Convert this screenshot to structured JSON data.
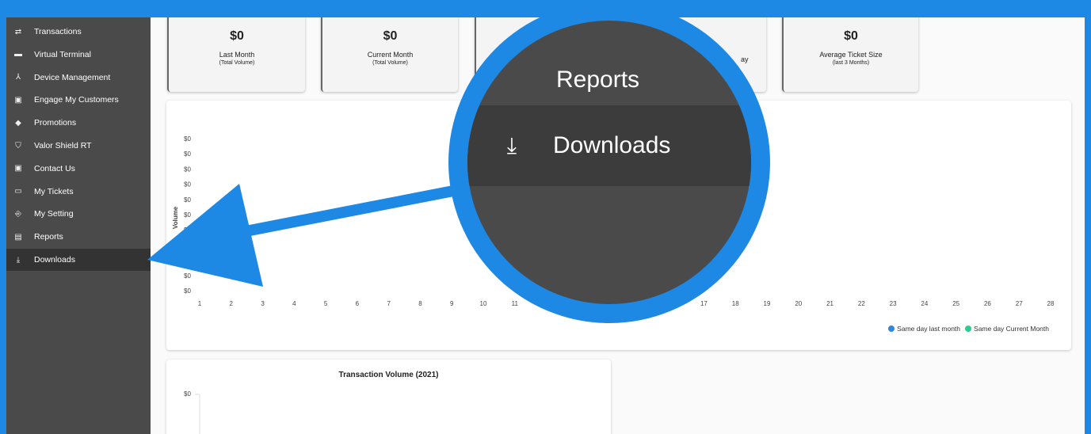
{
  "sidebar": {
    "items": [
      {
        "label": "Transactions",
        "icon": "transfer-arrows-icon",
        "glyph": "⇄"
      },
      {
        "label": "Virtual Terminal",
        "icon": "terminal-icon",
        "glyph": "▬"
      },
      {
        "label": "Device Management",
        "icon": "device-tree-icon",
        "glyph": "⅄"
      },
      {
        "label": "Engage My Customers",
        "icon": "contact-card-icon",
        "glyph": "▣"
      },
      {
        "label": "Promotions",
        "icon": "tag-icon",
        "glyph": "◆"
      },
      {
        "label": "Valor Shield RT",
        "icon": "shield-icon",
        "glyph": "⛉"
      },
      {
        "label": "Contact Us",
        "icon": "contact-card-icon",
        "glyph": "▣"
      },
      {
        "label": "My Tickets",
        "icon": "ticket-icon",
        "glyph": "▭"
      },
      {
        "label": "My Setting",
        "icon": "login-icon",
        "glyph": "⎆"
      },
      {
        "label": "Reports",
        "icon": "document-icon",
        "glyph": "▤"
      },
      {
        "label": "Downloads",
        "icon": "download-icon",
        "glyph": "⤓",
        "active": true
      }
    ]
  },
  "stats": [
    {
      "value": "$0",
      "title": "Last Month",
      "sub": "(Total Volume)"
    },
    {
      "value": "$0",
      "title": "Current Month",
      "sub": "(Total Volume)"
    },
    {
      "value": "",
      "title": "",
      "sub": ""
    },
    {
      "value": "",
      "title": "",
      "sub": ""
    },
    {
      "value": "$0",
      "title": "Average Ticket Size",
      "sub": "(last 3 Months)"
    }
  ],
  "stat_fragment": "ay",
  "chart_data": [
    {
      "type": "line",
      "ylabel": "Volume",
      "y_ticks": [
        "$0",
        "$0",
        "$0",
        "$0",
        "$0",
        "$0",
        "$0",
        "$0",
        "$0",
        "$0",
        "$0"
      ],
      "x": [
        1,
        2,
        3,
        4,
        5,
        6,
        7,
        8,
        9,
        10,
        11,
        17,
        18,
        19,
        20,
        21,
        22,
        23,
        24,
        25,
        26,
        27,
        28
      ],
      "series": [
        {
          "name": "Same day last month",
          "color": "#2e86de",
          "values": []
        },
        {
          "name": "Same day Current Month",
          "color": "#2ecc8f",
          "values": []
        }
      ]
    },
    {
      "type": "bar",
      "title": "Transaction Volume (2021)",
      "y_ticks": [
        "$0"
      ]
    }
  ],
  "magnifier": {
    "reports_label": "Reports",
    "downloads_label": "Downloads",
    "downloads_icon": "⤓"
  },
  "colors": {
    "accent": "#1e88e5",
    "sidebar": "#4a4a4a",
    "sidebar_active": "#333333"
  }
}
